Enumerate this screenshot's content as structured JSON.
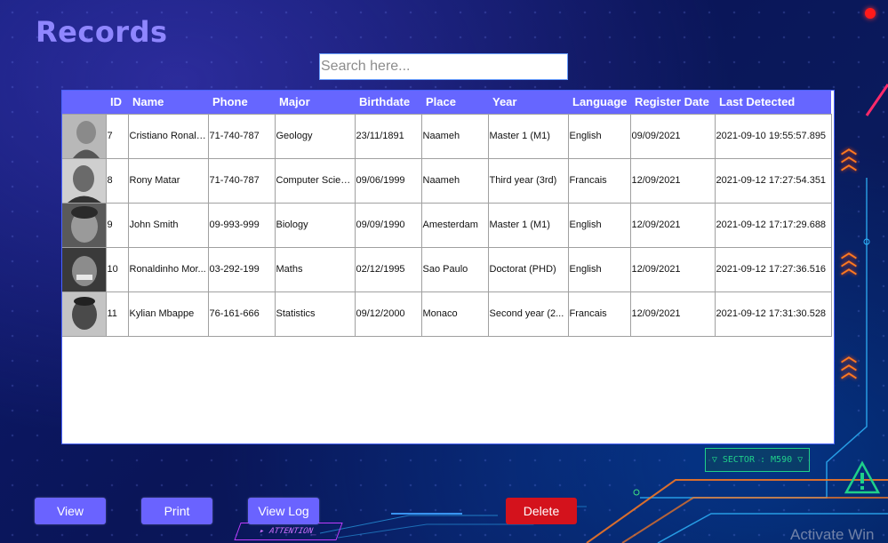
{
  "page": {
    "title": "Records"
  },
  "search": {
    "placeholder": "Search here..."
  },
  "table": {
    "columns": [
      "",
      "ID",
      "Name",
      "Phone",
      "Major",
      "Birthdate",
      "Place",
      "Year",
      "Language",
      "Register Date",
      "Last Detected"
    ],
    "rows": [
      {
        "id": "7",
        "name": "Cristiano Ronaldo",
        "phone": "71-740-787",
        "major": "Geology",
        "birthdate": "23/11/1891",
        "place": "Naameh",
        "year": "Master 1 (M1)",
        "language": "English",
        "register_date": "09/09/2021",
        "last_detected": "2021-09-10 19:55:57.895"
      },
      {
        "id": "8",
        "name": "Rony Matar",
        "phone": "71-740-787",
        "major": "Computer Science",
        "birthdate": "09/06/1999",
        "place": "Naameh",
        "year": "Third year (3rd)",
        "language": "Francais",
        "register_date": "12/09/2021",
        "last_detected": "2021-09-12 17:27:54.351"
      },
      {
        "id": "9",
        "name": "John Smith",
        "phone": "09-993-999",
        "major": "Biology",
        "birthdate": "09/09/1990",
        "place": "Amesterdam",
        "year": "Master 1 (M1)",
        "language": "English",
        "register_date": "12/09/2021",
        "last_detected": "2021-09-12 17:17:29.688"
      },
      {
        "id": "10",
        "name": "Ronaldinho Mor...",
        "phone": "03-292-199",
        "major": "Maths",
        "birthdate": "02/12/1995",
        "place": "Sao Paulo",
        "year": "Doctorat (PHD)",
        "language": "English",
        "register_date": "12/09/2021",
        "last_detected": "2021-09-12 17:27:36.516"
      },
      {
        "id": "11",
        "name": "Kylian Mbappe",
        "phone": "76-161-666",
        "major": "Statistics",
        "birthdate": "09/12/2000",
        "place": "Monaco",
        "year": "Second year (2...",
        "language": "Francais",
        "register_date": "12/09/2021",
        "last_detected": "2021-09-12 17:31:30.528"
      }
    ]
  },
  "buttons": {
    "view": "View",
    "print": "Print",
    "view_log": "View Log",
    "delete": "Delete"
  },
  "decor": {
    "sector_label": "▽ SECTOR : M590 ▽",
    "attention_label": "▸ ATTENTION_",
    "watermark": "Activate Win"
  },
  "colors": {
    "accent": "#6666ff",
    "title": "#8f86ff",
    "delete": "#d4121c",
    "alert_dot": "#ff1a1a"
  }
}
